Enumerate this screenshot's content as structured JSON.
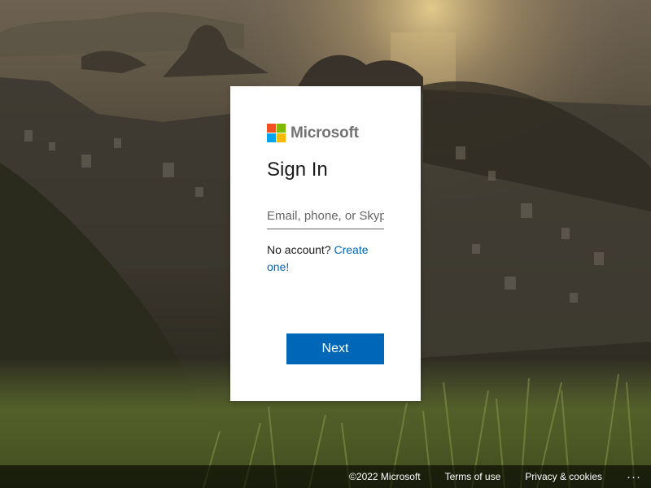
{
  "brand": {
    "name": "Microsoft",
    "logo_colors": [
      "#f25022",
      "#7fba00",
      "#00a4ef",
      "#ffb900"
    ]
  },
  "signin": {
    "title": "Sign In",
    "email_placeholder": "Email, phone, or Skype",
    "email_value": "",
    "no_account_text": "No account?",
    "create_link": "Create one!",
    "next_label": "Next"
  },
  "footer": {
    "copyright": "©2022 Microsoft",
    "terms": "Terms of use",
    "privacy": "Privacy & cookies",
    "more": "···"
  },
  "theme": {
    "accent": "#0067b8"
  }
}
